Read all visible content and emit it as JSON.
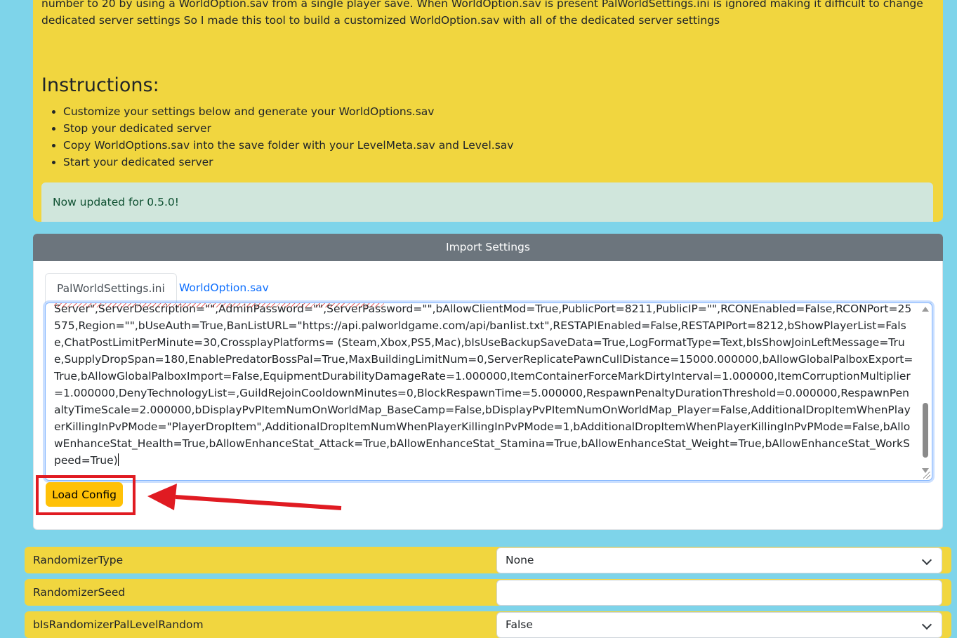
{
  "intro": {
    "description": "number to 20 by using a WorldOption.sav from a single player save. When WorldOption.sav is present PalWorldSettings.ini is ignored making it difficult to change dedicated server settings So I made this tool to build a customized WorldOption.sav with all of the dedicated server settings",
    "instructions_title": "Instructions:",
    "steps": [
      "Customize your settings below and generate your WorldOptions.sav",
      "Stop your dedicated server",
      "Copy WorldOptions.sav into the save folder with your LevelMeta.sav and Level.sav",
      "Start your dedicated server"
    ],
    "update_notice": "Now updated for 0.5.0!"
  },
  "import": {
    "header": "Import Settings",
    "tabs": [
      {
        "label": "PalWorldSettings.ini",
        "active": true
      },
      {
        "label": "WorldOption.sav",
        "active": false
      }
    ],
    "config_text": "Server\",ServerDescription=\"\",AdminPassword=\"\",ServerPassword=\"\",bAllowClientMod=True,PublicPort=8211,PublicIP=\"\",RCONEnabled=False,RCONPort=25575,Region=\"\",bUseAuth=True,BanListURL=\"https://api.palworldgame.com/api/banlist.txt\",RESTAPIEnabled=False,RESTAPIPort=8212,bShowPlayerList=False,ChatPostLimitPerMinute=30,CrossplayPlatforms=\n(Steam,Xbox,PS5,Mac),bIsUseBackupSaveData=True,LogFormatType=Text,bIsShowJoinLeftMessage=True,SupplyDropSpan=180,EnablePredatorBossPal=True,MaxBuildingLimitNum=0,ServerReplicatePawnCullDistance=15000.000000,bAllowGlobalPalboxExport=True,bAllowGlobalPalboxImport=False,EquipmentDurabilityDamageRate=1.000000,ItemContainerForceMarkDirtyInterval=1.000000,ItemCorruptionMultiplier=1.000000,DenyTechnologyList=,GuildRejoinCooldownMinutes=0,BlockRespawnTime=5.000000,RespawnPenaltyDurationThreshold=0.000000,RespawnPenaltyTimeScale=2.000000,bDisplayPvPItemNumOnWorldMap_BaseCamp=False,bDisplayPvPItemNumOnWorldMap_Player=False,AdditionalDropItemWhenPlayerKillingInPvPMode=\"PlayerDropItem\",AdditionalDropItemNumWhenPlayerKillingInPvPMode=1,bAdditionalDropItemWhenPlayerKillingInPvPMode=False,bAllowEnhanceStat_Health=True,bAllowEnhanceStat_Attack=True,bAllowEnhanceStat_Stamina=True,bAllowEnhanceStat_Weight=True,bAllowEnhanceStat_WorkSpeed=True)",
    "load_button": "Load Config"
  },
  "settings": [
    {
      "label": "RandomizerType",
      "value": "None",
      "kind": "select"
    },
    {
      "label": "RandomizerSeed",
      "value": "",
      "kind": "input"
    },
    {
      "label": "bIsRandomizerPalLevelRandom",
      "value": "False",
      "kind": "select"
    }
  ],
  "colors": {
    "page_bg": "#7ed4ea",
    "panel_yellow": "#f1d63f",
    "header_gray": "#6c757d",
    "button_yellow": "#ffc107",
    "annotation_red": "#e01b22"
  }
}
